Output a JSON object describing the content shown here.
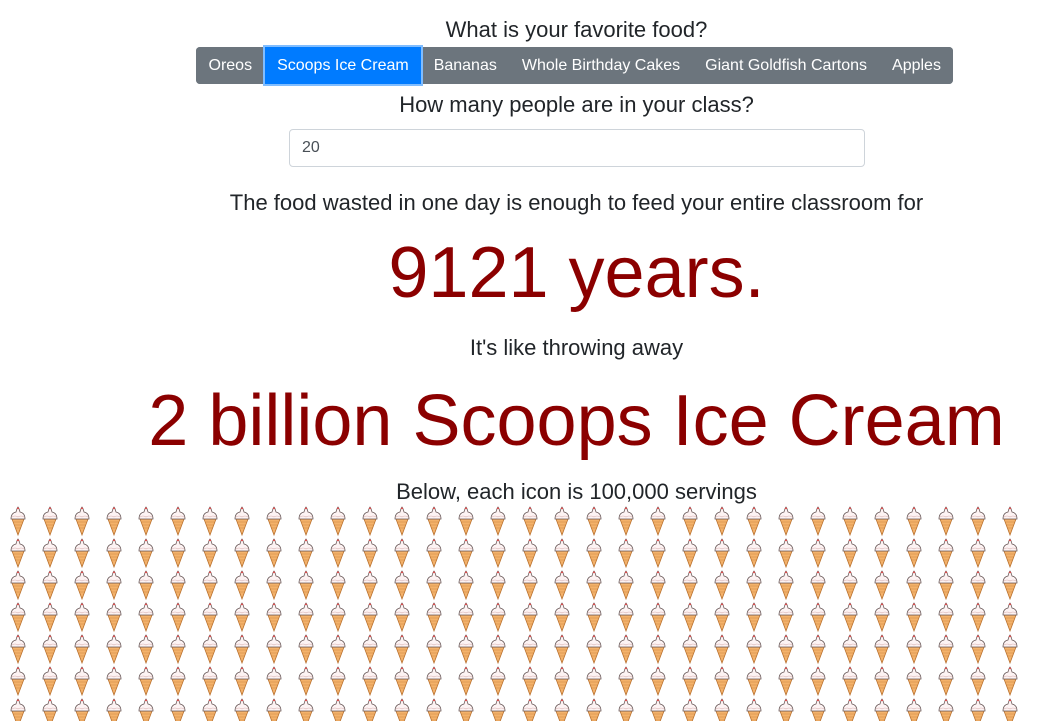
{
  "food_question": "What is your favorite food?",
  "food_options": [
    {
      "label": "Oreos",
      "active": false
    },
    {
      "label": "Scoops Ice Cream",
      "active": true
    },
    {
      "label": "Bananas",
      "active": false
    },
    {
      "label": "Whole Birthday Cakes",
      "active": false
    },
    {
      "label": "Giant Goldfish Cartons",
      "active": false
    },
    {
      "label": "Apples",
      "active": false
    }
  ],
  "class_question": "How many people are in your class?",
  "class_size": "20",
  "waste_text": "The food wasted in one day is enough to feed your entire classroom for",
  "years_text": "9121 years.",
  "like_text": "It's like throwing away",
  "count_food_text": "2 billion Scoops Ice Cream",
  "below_text": "Below, each icon is 100,000 servings",
  "icon_name": "ice-cream-cone-icon",
  "colors": {
    "accent_blue": "#007bff",
    "button_gray": "#6c757d",
    "highlight_red": "#8b0000",
    "cone": "#f4b26a",
    "cream": "#fdf3f3",
    "cream_tip": "#d94a4a"
  }
}
